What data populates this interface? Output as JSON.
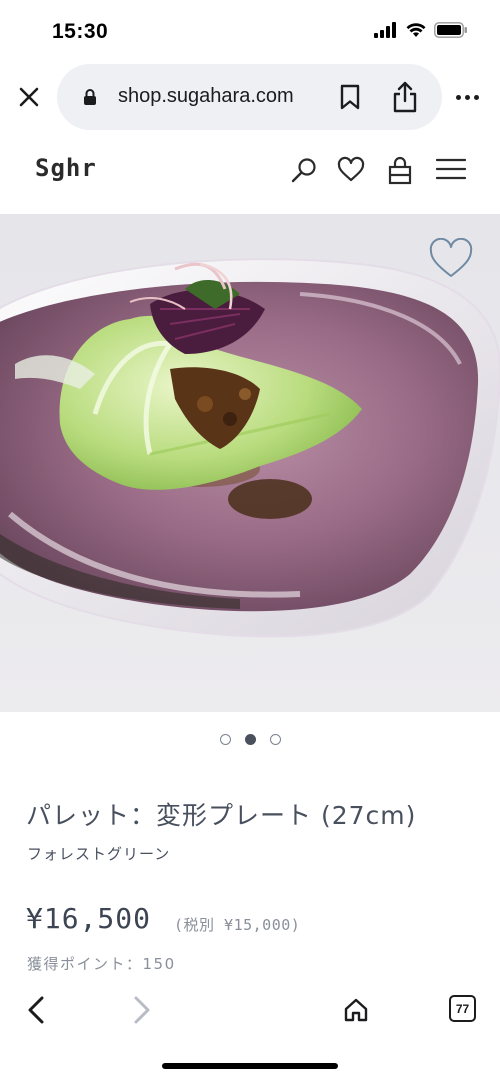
{
  "status_bar": {
    "time": "15:30"
  },
  "browser": {
    "url": "shop.sugahara.com",
    "tab_count": "77"
  },
  "site": {
    "logo": "Sghr"
  },
  "carousel": {
    "slide_count": 3,
    "active_index": 1
  },
  "product": {
    "title": "パレット：変形プレート (27cm)",
    "variant": "フォレストグリーン",
    "price": "¥16,500",
    "price_tax_note": "(税別 ¥15,000)",
    "points": "獲得ポイント：150"
  },
  "icons": {
    "close": "close-icon",
    "lock": "lock-icon",
    "bookmark": "bookmark-icon",
    "share": "share-icon",
    "more": "more-icon",
    "search": "search-icon",
    "favorite": "heart-icon",
    "cart": "shopping-bag-icon",
    "menu": "hamburger-menu-icon",
    "back": "chevron-left-icon",
    "forward": "chevron-right-icon",
    "home": "home-icon",
    "tabs": "tabs-icon"
  },
  "colors": {
    "text_primary": "#48505e",
    "text_muted": "#8a909b",
    "url_bar_bg": "#eef0f3"
  }
}
